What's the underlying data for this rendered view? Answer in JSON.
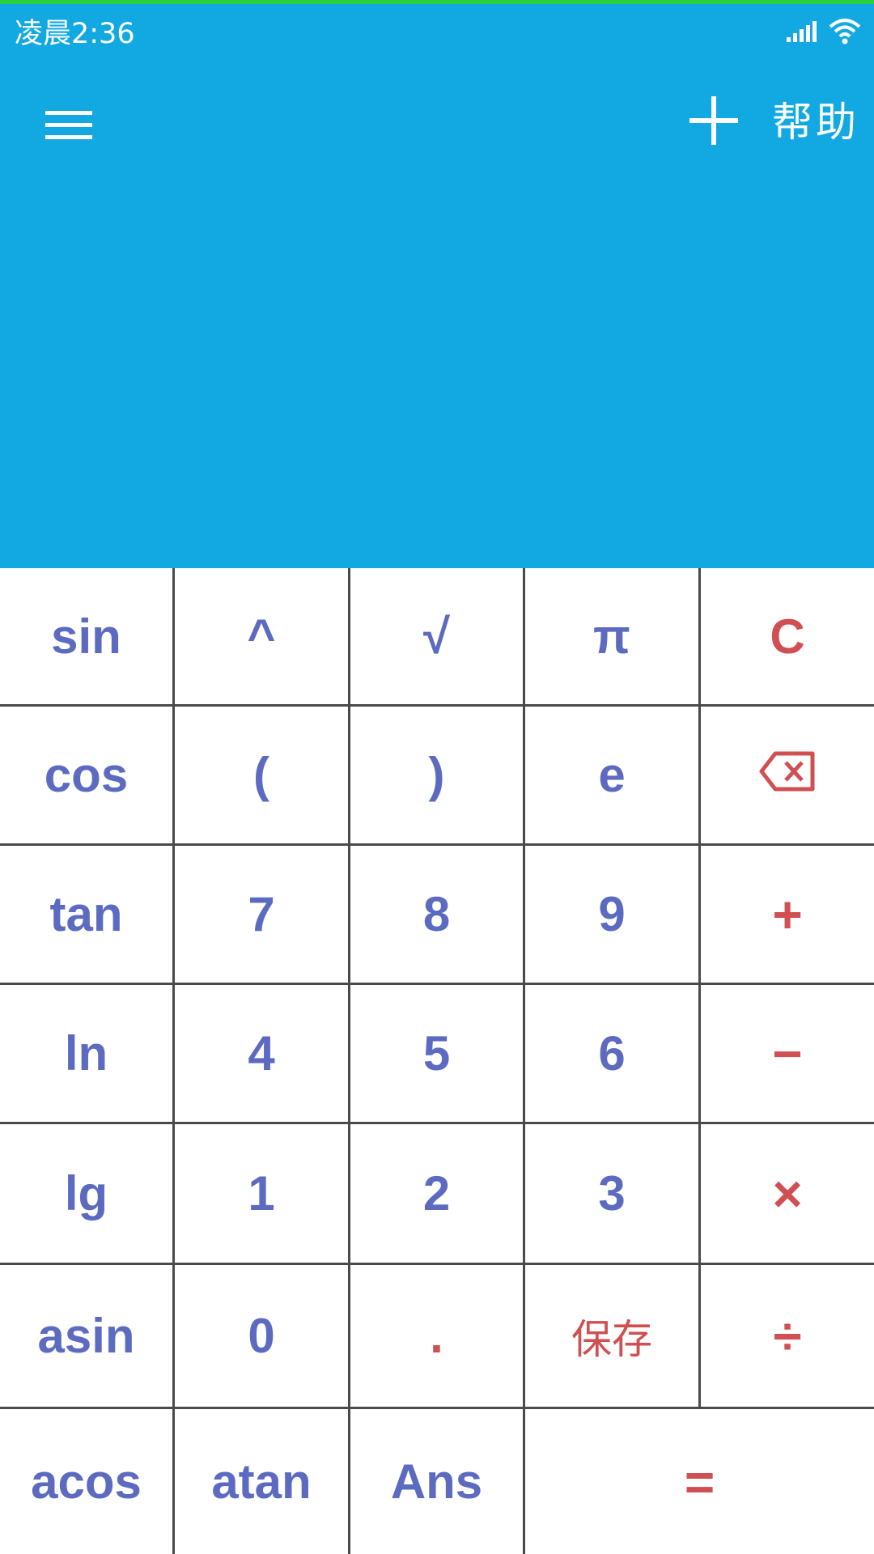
{
  "status_bar": {
    "time": "凌晨2:36",
    "signal_icon": "cellular-signal-icon",
    "wifi_icon": "wifi-icon"
  },
  "app_bar": {
    "menu_icon": "hamburger-menu-icon",
    "add_icon": "plus-icon",
    "help_label": "帮助"
  },
  "display": {
    "expression": "",
    "result": ""
  },
  "colors": {
    "header_bg": "#12a8e2",
    "key_text": "#5c6bc0",
    "key_accent": "#cf4f52",
    "top_accent_line": "#2bd13a"
  },
  "keys": {
    "sin": "sin",
    "pow": "^",
    "sqrt": "√",
    "pi": "π",
    "clear": "C",
    "cos": "cos",
    "lparen": "(",
    "rparen": ")",
    "e": "e",
    "backspace_icon": "backspace-icon",
    "tan": "tan",
    "seven": "7",
    "eight": "8",
    "nine": "9",
    "plus": "+",
    "ln": "ln",
    "four": "4",
    "five": "5",
    "six": "6",
    "minus": "−",
    "lg": "lg",
    "one": "1",
    "two": "2",
    "three": "3",
    "times": "×",
    "asin": "asin",
    "zero": "0",
    "dot": ".",
    "save": "保存",
    "divide": "÷",
    "acos": "acos",
    "atan": "atan",
    "ans": "Ans",
    "equals": "="
  }
}
